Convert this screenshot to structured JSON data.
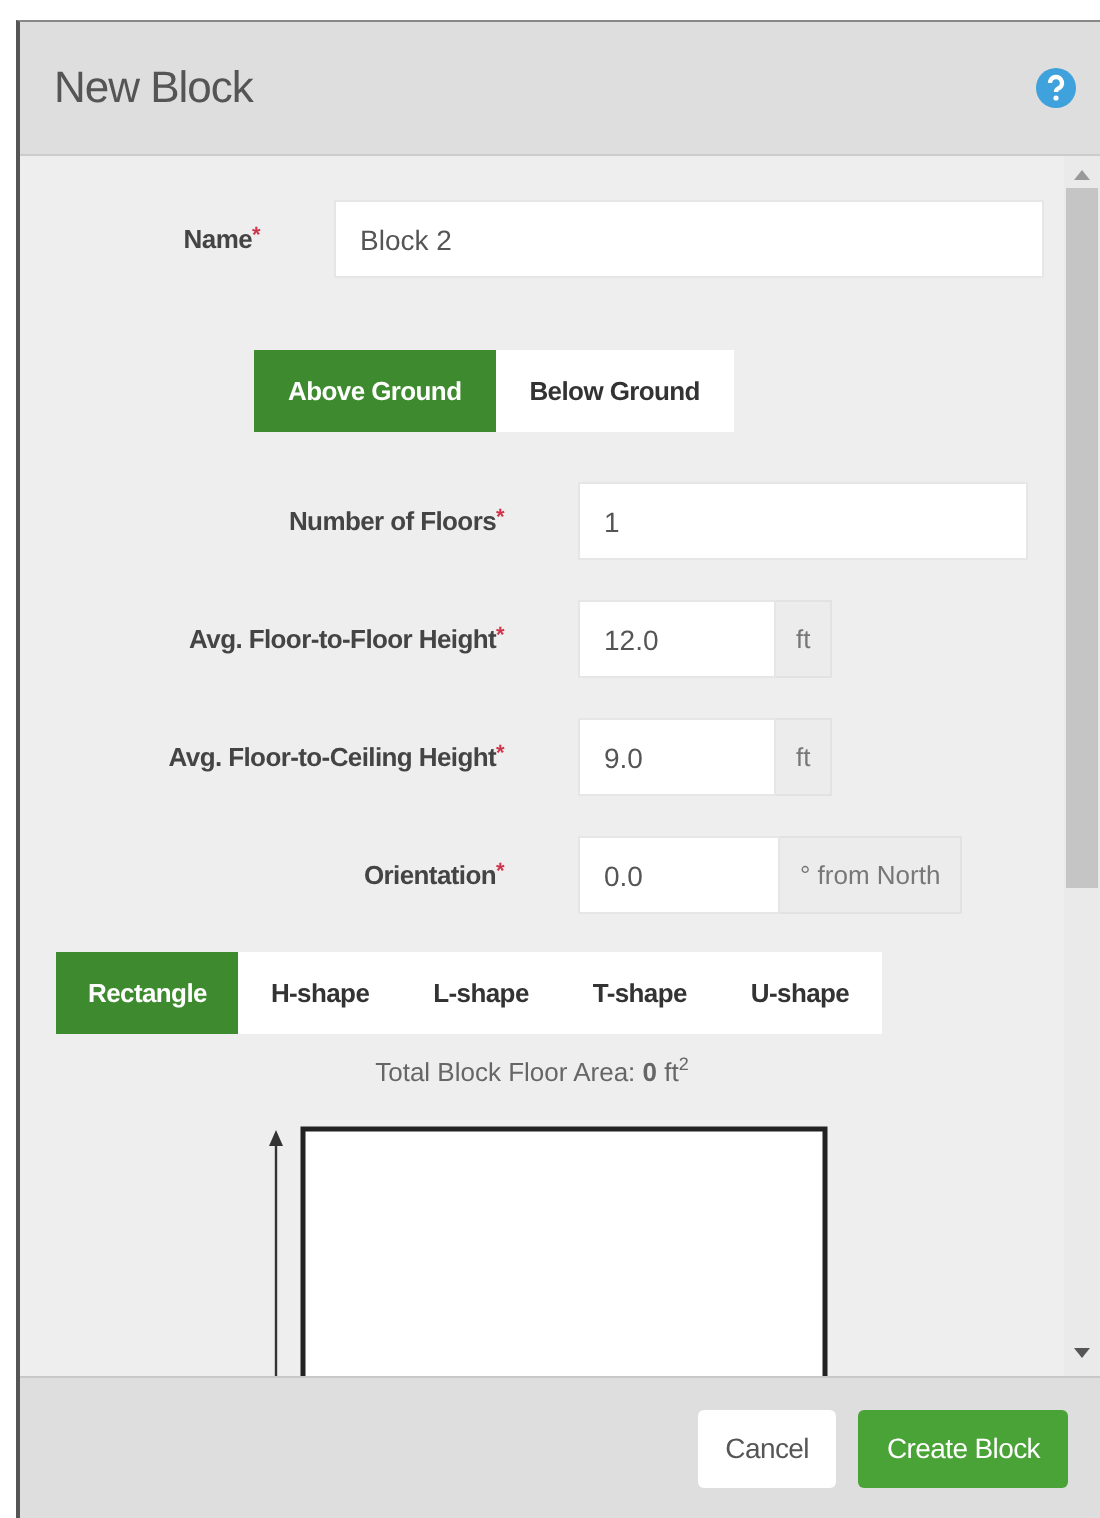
{
  "dialog": {
    "title": "New Block"
  },
  "name_field": {
    "label": "Name",
    "mark": "*",
    "value": "Block 2"
  },
  "ground_toggle": [
    {
      "label": "Above Ground",
      "selected": true
    },
    {
      "label": "Below Ground",
      "selected": false
    }
  ],
  "fields": [
    {
      "label": "Number of Floors",
      "mark": "*",
      "value": "1",
      "kind": "plain"
    },
    {
      "label": "Avg. Floor-to-Floor Height",
      "mark": "*",
      "value": "12.0",
      "unit": "ft",
      "kind": "unit"
    },
    {
      "label": "Avg. Floor-to-Ceiling Height",
      "mark": "*",
      "value": "9.0",
      "unit": "ft",
      "kind": "unit"
    },
    {
      "label": "Orientation",
      "mark": "*",
      "value": "0.0",
      "unit": "° from North",
      "kind": "unit"
    }
  ],
  "shape_tabs": [
    {
      "label": "Rectangle",
      "selected": true
    },
    {
      "label": "H-shape",
      "selected": false
    },
    {
      "label": "L-shape",
      "selected": false
    },
    {
      "label": "T-shape",
      "selected": false
    },
    {
      "label": "U-shape",
      "selected": false
    }
  ],
  "floor_area": "Total Block Floor Area: **0** ft$^{2}$",
  "buttons": [
    {
      "label": "Cancel",
      "kind": "secondary"
    },
    {
      "label": "Create Block",
      "kind": "primary"
    }
  ]
}
